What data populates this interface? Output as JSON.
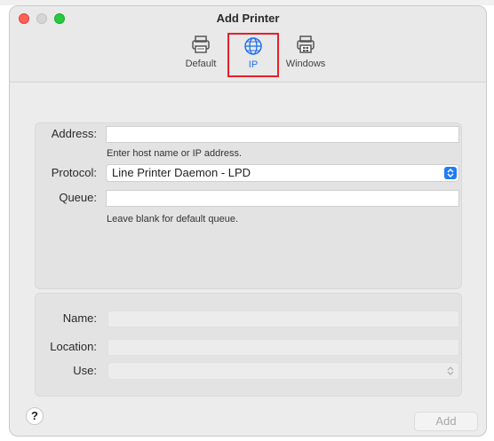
{
  "window": {
    "title": "Add Printer"
  },
  "toolbar": {
    "tabs": [
      {
        "label": "Default",
        "icon": "printer-icon"
      },
      {
        "label": "IP",
        "icon": "globe-icon"
      },
      {
        "label": "Windows",
        "icon": "windows-printer-icon"
      }
    ],
    "selected": "IP",
    "highlight_color": "#e5202a",
    "accent_color": "#1d6ff2"
  },
  "form": {
    "address": {
      "label": "Address:",
      "value": "",
      "hint": "Enter host name or IP address."
    },
    "protocol": {
      "label": "Protocol:",
      "value": "Line Printer Daemon - LPD"
    },
    "queue": {
      "label": "Queue:",
      "value": "",
      "hint": "Leave blank for default queue."
    }
  },
  "details": {
    "name": {
      "label": "Name:",
      "value": ""
    },
    "location": {
      "label": "Location:",
      "value": ""
    },
    "use": {
      "label": "Use:",
      "value": ""
    }
  },
  "footer": {
    "help_label": "?",
    "add_label": "Add"
  }
}
